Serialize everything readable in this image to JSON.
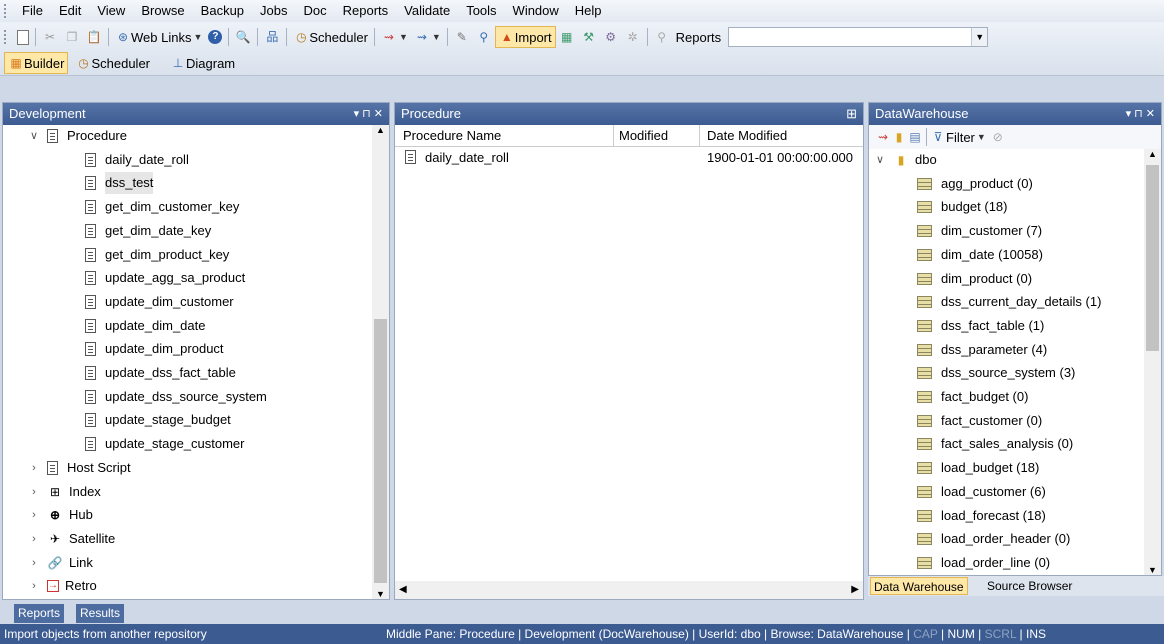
{
  "menu": [
    "File",
    "Edit",
    "View",
    "Browse",
    "Backup",
    "Jobs",
    "Doc",
    "Reports",
    "Validate",
    "Tools",
    "Window",
    "Help"
  ],
  "toolbar": {
    "web_links_label": "Web Links",
    "scheduler_label": "Scheduler",
    "import_label": "Import",
    "reports_label": "Reports",
    "reports_value": ""
  },
  "view_tabs": {
    "builder": "Builder",
    "scheduler": "Scheduler",
    "diagram": "Diagram"
  },
  "left_pane": {
    "title": "Development",
    "ctrl": "▾ ⊓ ✕",
    "procedure_label": "Procedure",
    "procedures": [
      "daily_date_roll",
      "dss_test",
      "get_dim_customer_key",
      "get_dim_date_key",
      "get_dim_product_key",
      "update_agg_sa_product",
      "update_dim_customer",
      "update_dim_date",
      "update_dim_product",
      "update_dss_fact_table",
      "update_dss_source_system",
      "update_stage_budget",
      "update_stage_customer"
    ],
    "groups": [
      "Host Script",
      "Index",
      "Hub",
      "Satellite",
      "Link",
      "Retro"
    ]
  },
  "middle_pane": {
    "title": "Procedure",
    "columns": [
      "Procedure Name",
      "Modified",
      "Date Modified"
    ],
    "rows": [
      {
        "name": "daily_date_roll",
        "modified": "",
        "date_modified": "1900-01-01 00:00:00.000"
      }
    ]
  },
  "right_pane": {
    "title": "DataWarehouse",
    "filter_label": "Filter",
    "schema": "dbo",
    "tables": [
      "agg_product (0)",
      "budget (18)",
      "dim_customer (7)",
      "dim_date (10058)",
      "dim_product (0)",
      "dss_current_day_details (1)",
      "dss_fact_table (1)",
      "dss_parameter (4)",
      "dss_source_system (3)",
      "fact_budget (0)",
      "fact_customer (0)",
      "fact_sales_analysis (0)",
      "load_budget (18)",
      "load_customer (6)",
      "load_forecast (18)",
      "load_order_header (0)",
      "load_order_line (0)"
    ],
    "bottom_tabs": [
      "Data Warehouse",
      "Source Browser"
    ]
  },
  "bottom_tabs": [
    "Reports",
    "Results"
  ],
  "status": {
    "left": "Import objects from another repository",
    "middle": "Middle Pane: Procedure",
    "repo": "Development (DocWarehouse)",
    "user": "UserId: dbo",
    "browse": "Browse: DataWarehouse",
    "cap": "CAP",
    "num": "NUM",
    "scrl": "SCRL",
    "ins": "INS"
  },
  "colors": {
    "title_bar": "#3c5b91",
    "highlight": "#fde8a8",
    "status_bar": "#3c5b91"
  }
}
